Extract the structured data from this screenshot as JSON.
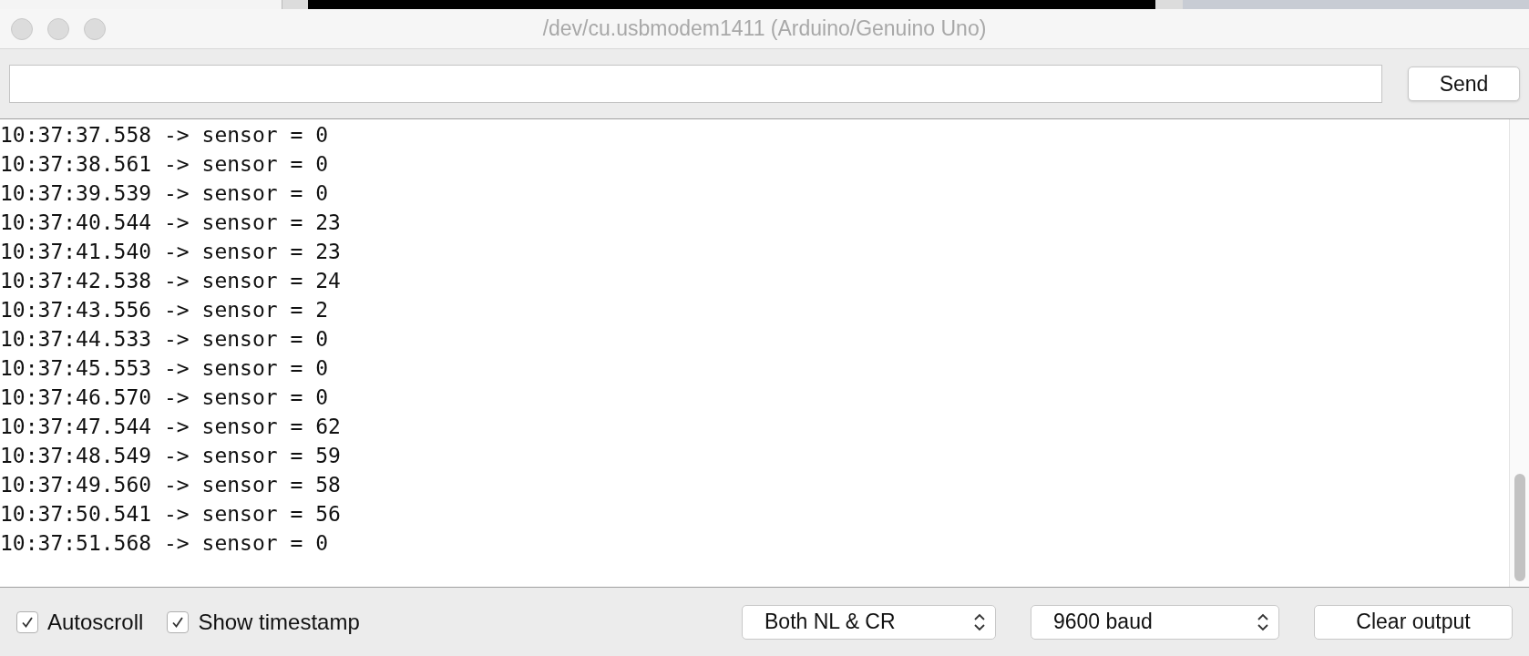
{
  "window": {
    "title": "/dev/cu.usbmodem1411 (Arduino/Genuino Uno)"
  },
  "send_bar": {
    "button": "Send"
  },
  "output_lines": [
    "10:37:37.558 -> sensor = 0",
    "10:37:38.561 -> sensor = 0",
    "10:37:39.539 -> sensor = 0",
    "10:37:40.544 -> sensor = 23",
    "10:37:41.540 -> sensor = 23",
    "10:37:42.538 -> sensor = 24",
    "10:37:43.556 -> sensor = 2",
    "10:37:44.533 -> sensor = 0",
    "10:37:45.553 -> sensor = 0",
    "10:37:46.570 -> sensor = 0",
    "10:37:47.544 -> sensor = 62",
    "10:37:48.549 -> sensor = 59",
    "10:37:49.560 -> sensor = 58",
    "10:37:50.541 -> sensor = 56",
    "10:37:51.568 -> sensor = 0"
  ],
  "footer": {
    "checkboxes": [
      {
        "label": "Autoscroll",
        "checked": true
      },
      {
        "label": "Show timestamp",
        "checked": true
      }
    ],
    "dropdowns": [
      "Both NL & CR",
      "9600 baud"
    ],
    "button": "Clear output"
  }
}
